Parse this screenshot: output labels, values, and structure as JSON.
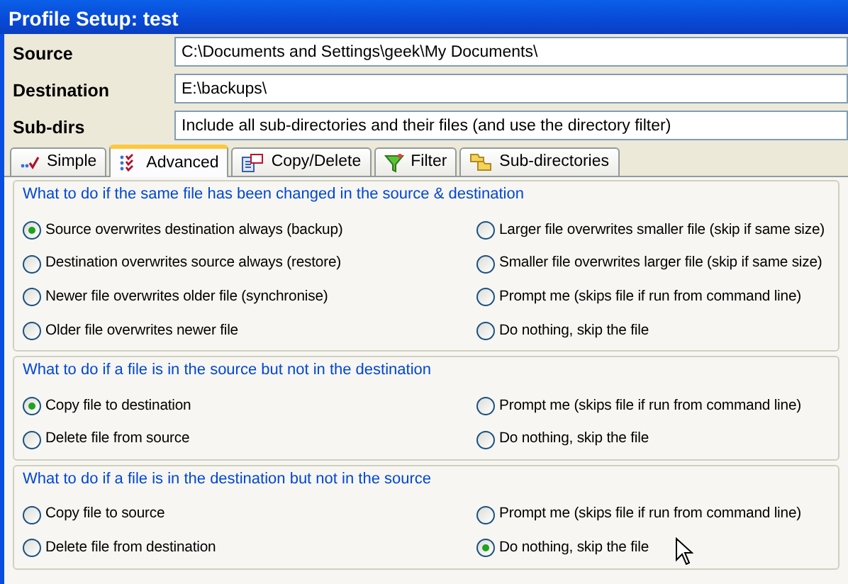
{
  "window": {
    "title": "Profile Setup: test"
  },
  "fields": [
    {
      "label": "Source",
      "value": "C:\\Documents and Settings\\geek\\My Documents\\"
    },
    {
      "label": "Destination",
      "value": "E:\\backups\\"
    },
    {
      "label": "Sub-dirs",
      "value": "Include all sub-directories and their files (and use the directory filter)"
    }
  ],
  "tabs": [
    {
      "label": "Simple",
      "selected": false
    },
    {
      "label": "Advanced",
      "selected": true
    },
    {
      "label": "Copy/Delete",
      "selected": false
    },
    {
      "label": "Filter",
      "selected": false
    },
    {
      "label": "Sub-directories",
      "selected": false
    }
  ],
  "groups": [
    {
      "title": "What to do if the same file has been changed in the source & destination",
      "options": [
        {
          "label": "Source overwrites destination always (backup)",
          "selected": true
        },
        {
          "label": "Larger file overwrites smaller file (skip if same size)",
          "selected": false
        },
        {
          "label": "Destination overwrites source always (restore)",
          "selected": false
        },
        {
          "label": "Smaller file overwrites larger file (skip if same size)",
          "selected": false
        },
        {
          "label": "Newer file overwrites older file (synchronise)",
          "selected": false
        },
        {
          "label": "Prompt me (skips file if run from command line)",
          "selected": false
        },
        {
          "label": "Older file overwrites newer file",
          "selected": false
        },
        {
          "label": "Do nothing, skip the file",
          "selected": false
        }
      ]
    },
    {
      "title": "What to do if a file is in the source but not in the destination",
      "options": [
        {
          "label": "Copy file to destination",
          "selected": true
        },
        {
          "label": "Prompt me  (skips file if run from command line)",
          "selected": false
        },
        {
          "label": "Delete file from source",
          "selected": false
        },
        {
          "label": "Do nothing, skip the file",
          "selected": false
        }
      ]
    },
    {
      "title": "What to do if a file is in the destination but not in the source",
      "options": [
        {
          "label": "Copy file to source",
          "selected": false
        },
        {
          "label": "Prompt me  (skips file if run from command line)",
          "selected": false
        },
        {
          "label": "Delete file from destination",
          "selected": false
        },
        {
          "label": "Do nothing, skip the file",
          "selected": true
        }
      ]
    }
  ]
}
